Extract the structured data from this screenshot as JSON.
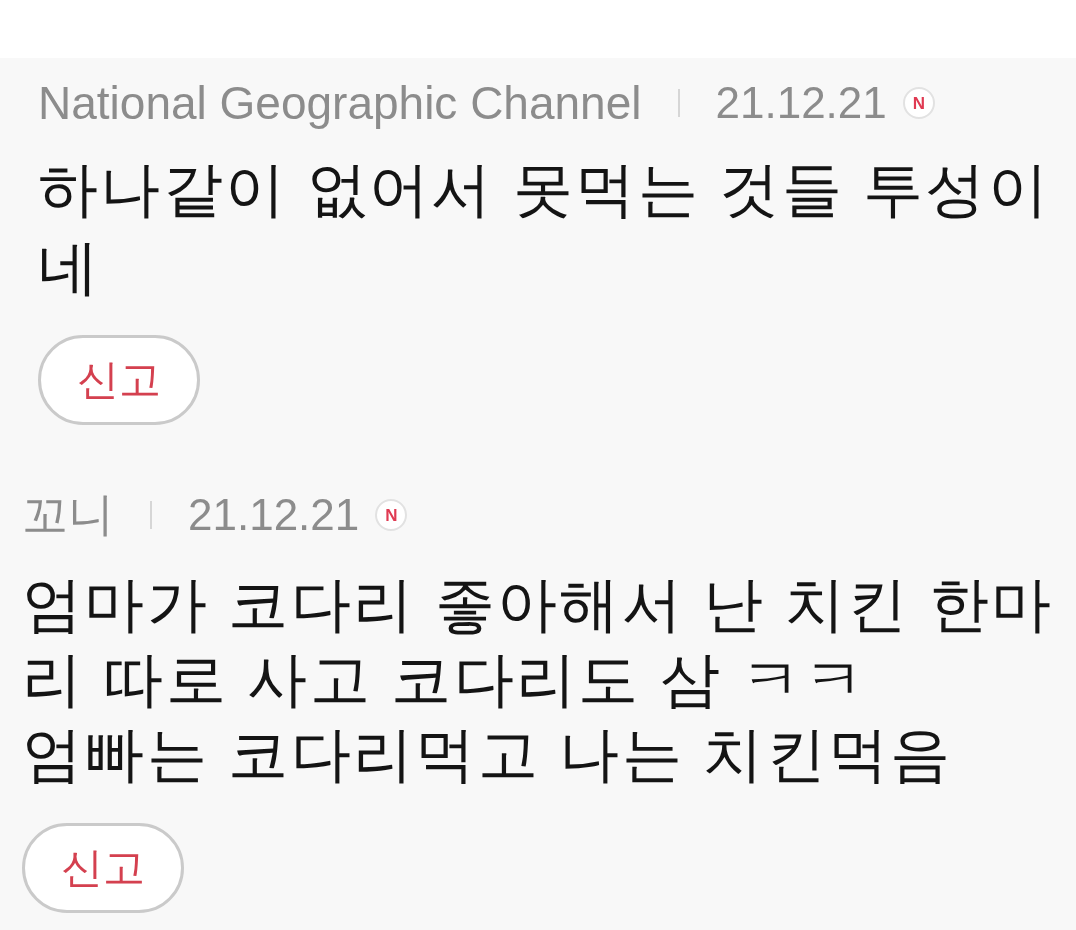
{
  "comments": [
    {
      "author": "National Geographic Channel",
      "date": "21.12.21",
      "badge": "N",
      "text": "하나같이 없어서 못먹는 것들 투성이네",
      "report_button": "신고"
    },
    {
      "author": "꼬니",
      "date": "21.12.21",
      "badge": "N",
      "text": "엄마가 코다리 좋아해서 난 치킨 한마리 따로 사고 코다리도 삼 ㅋㅋ\n엄빠는 코다리먹고 나는 치킨먹음",
      "report_button": "신고"
    }
  ]
}
